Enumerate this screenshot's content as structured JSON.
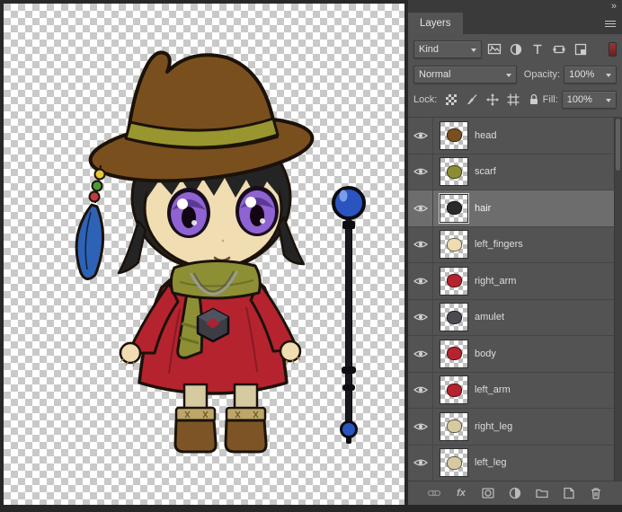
{
  "panel": {
    "collapse_icon": "»",
    "tab": "Layers",
    "filter": {
      "kind_label": "Kind",
      "icons": [
        "pixel-filter",
        "adjustment-filter",
        "type-filter",
        "shape-filter",
        "smart-object-filter"
      ]
    },
    "blend_mode": "Normal",
    "opacity_label": "Opacity:",
    "opacity_value": "100%",
    "lock_label": "Lock:",
    "fill_label": "Fill:",
    "fill_value": "100%",
    "layers": [
      {
        "name": "head",
        "selected": false,
        "thumb_color": "#7a4f1e"
      },
      {
        "name": "scarf",
        "selected": false,
        "thumb_color": "#8b8d33"
      },
      {
        "name": "hair",
        "selected": true,
        "thumb_color": "#2a2a2a"
      },
      {
        "name": "left_fingers",
        "selected": false,
        "thumb_color": "#efdcb2"
      },
      {
        "name": "right_arm",
        "selected": false,
        "thumb_color": "#b5232f"
      },
      {
        "name": "amulet",
        "selected": false,
        "thumb_color": "#4a4a52"
      },
      {
        "name": "body",
        "selected": false,
        "thumb_color": "#b5232f"
      },
      {
        "name": "left_arm",
        "selected": false,
        "thumb_color": "#b5232f"
      },
      {
        "name": "right_leg",
        "selected": false,
        "thumb_color": "#d6caa0"
      },
      {
        "name": "left_leg",
        "selected": false,
        "thumb_color": "#d6caa0"
      }
    ],
    "footer": {
      "fx_label": "fx"
    }
  },
  "palette": {
    "outline": "#1b1209",
    "hat": "#7a4f1e",
    "hatband": "#99952f",
    "hair": "#242424",
    "skin": "#f0ddb2",
    "iris": "#8f63d2",
    "irisdark": "#5b3a94",
    "dress": "#b5232f",
    "dressfold": "#871a24",
    "scarf": "#8d8f35",
    "scarfdark": "#6d7026",
    "leg": "#d6caa0",
    "cuff": "#bda768",
    "boot": "#7d5426",
    "feather": "#2d62b5",
    "orb": "#2a55c0",
    "orbhi": "#7b9ce8",
    "staff": "#17171c",
    "pendant": "#3c3c44",
    "pendantface": "#52525e",
    "pendantred": "#a82430",
    "bead1": "#e8c832",
    "bead2": "#4a9a3a",
    "bead3": "#c03a3a",
    "chain": "#9b9b9b"
  }
}
